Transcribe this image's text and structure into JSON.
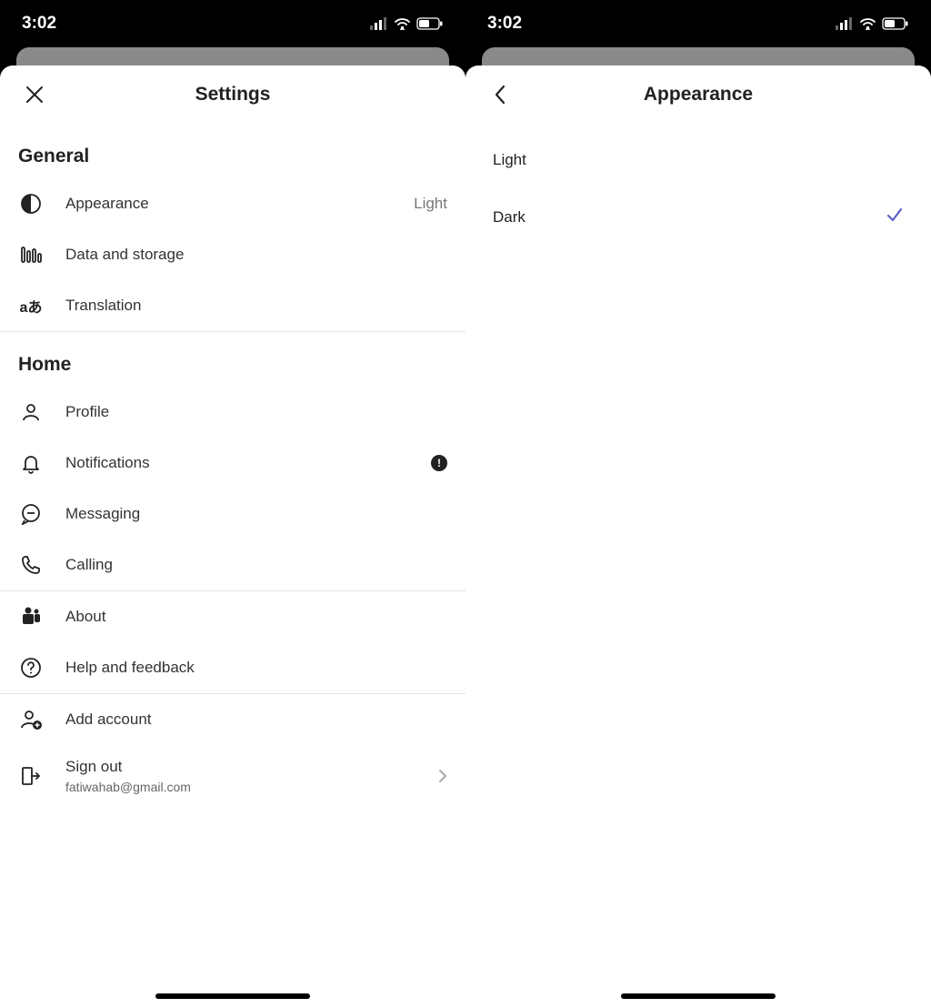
{
  "status": {
    "time": "3:02"
  },
  "left": {
    "title": "Settings",
    "sections": {
      "general": {
        "header": "General",
        "appearance": {
          "label": "Appearance",
          "value": "Light"
        },
        "data_storage": {
          "label": "Data and storage"
        },
        "translation": {
          "label": "Translation"
        }
      },
      "home": {
        "header": "Home",
        "profile": {
          "label": "Profile"
        },
        "notifications": {
          "label": "Notifications",
          "alert": "!"
        },
        "messaging": {
          "label": "Messaging"
        },
        "calling": {
          "label": "Calling"
        }
      },
      "about_group": {
        "about": {
          "label": "About"
        },
        "help": {
          "label": "Help and feedback"
        }
      },
      "account": {
        "add_account": {
          "label": "Add account"
        },
        "sign_out": {
          "label": "Sign out",
          "sub": "fatiwahab@gmail.com"
        }
      }
    }
  },
  "right": {
    "title": "Appearance",
    "options": {
      "light": {
        "label": "Light",
        "selected": false
      },
      "dark": {
        "label": "Dark",
        "selected": true
      }
    }
  }
}
